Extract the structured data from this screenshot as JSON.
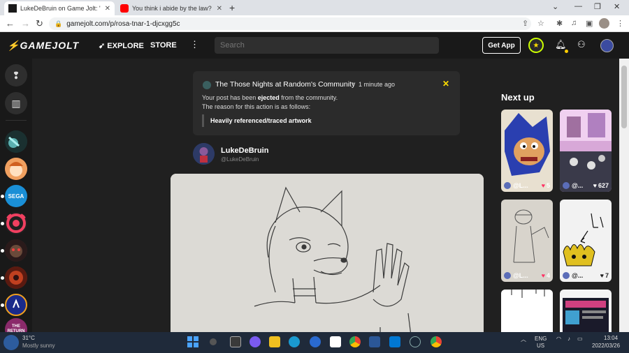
{
  "browser": {
    "tabs": [
      {
        "title": "LukeDeBruin on Game Jolt: \"rosa",
        "active": true
      },
      {
        "title": "You think i abide by the law? - Yo",
        "active": false
      }
    ],
    "url": "gamejolt.com/p/rosa-tnar-1-djcxgg5c"
  },
  "header": {
    "logo": "GAMEJOLT",
    "explore": "EXPLORE",
    "store": "STORE",
    "search_placeholder": "Search",
    "get_app": "Get App"
  },
  "sidebar": {
    "communities": [
      {
        "name": "community-1",
        "color": "#1a3a3a"
      },
      {
        "name": "community-2",
        "color": "#e07a3a"
      },
      {
        "name": "sega",
        "label": "SEGA",
        "color": "#1a8fd6"
      },
      {
        "name": "community-4",
        "color": "#f04060"
      },
      {
        "name": "community-5",
        "color": "#3a2a2a"
      },
      {
        "name": "community-6",
        "color": "#7a2a1a"
      },
      {
        "name": "community-7",
        "color": "#1a2a8a"
      },
      {
        "name": "community-8",
        "label": "THE RETURN",
        "color": "#8a2a6a"
      }
    ]
  },
  "notice": {
    "community": "The Those Nights at Random's Community",
    "separator": "•",
    "time": "1 minute ago",
    "line1_prefix": "Your post has been ",
    "line1_emph": "ejected",
    "line1_suffix": " from the community.",
    "line2": "The reason for this action is as follows:",
    "reason": "Heavily referenced/traced artwork"
  },
  "author": {
    "name": "LukeDeBruin",
    "handle": "@LukeDeBruin"
  },
  "next_up": {
    "title": "Next up",
    "cards": [
      {
        "user": "@L...",
        "likes": "5",
        "colors": [
          "#2a3fb0",
          "#e0a060"
        ]
      },
      {
        "user": "@...",
        "likes": "627",
        "colors": [
          "#c090c0",
          "#3a3a4a"
        ]
      },
      {
        "user": "@L...",
        "likes": "4",
        "colors": [
          "#d8d4cc",
          "#b8b4ac"
        ]
      },
      {
        "user": "@...",
        "likes": "7",
        "colors": [
          "#f0f0f0",
          "#e0c020"
        ]
      },
      {
        "user": "",
        "likes": "",
        "colors": [
          "#ffffff",
          "#eeeeee"
        ]
      },
      {
        "user": "",
        "likes": "",
        "colors": [
          "#1a1a2a",
          "#d04080"
        ]
      }
    ]
  },
  "taskbar": {
    "weather_temp": "31°C",
    "weather_desc": "Mostly sunny",
    "lang1": "ENG",
    "lang2": "US",
    "time": "13:04",
    "date": "2022/03/26"
  },
  "colors": {
    "accent": "#ccff00",
    "yellow": "#ffde00",
    "heart": "#ff3366"
  }
}
